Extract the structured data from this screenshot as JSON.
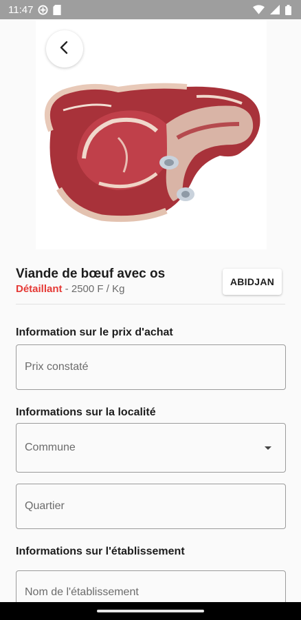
{
  "status_bar": {
    "time": "11:47"
  },
  "product": {
    "name": "Viande de bœuf avec os",
    "seller_type": "Détaillant",
    "separator": " - ",
    "price": "2500 F",
    "unit": " / Kg",
    "city": "ABIDJAN"
  },
  "sections": {
    "purchase_price": {
      "label": "Information sur le prix d'achat",
      "price_placeholder": "Prix constaté"
    },
    "locality": {
      "label": "Informations sur la localité",
      "commune_placeholder": "Commune",
      "quartier_placeholder": "Quartier"
    },
    "establishment": {
      "label": "Informations sur l'établissement",
      "name_placeholder": "Nom de l'établissement"
    }
  },
  "colors": {
    "accent_red": "#e53935",
    "status_bar": "#9e9e9e",
    "background": "#fafafa"
  },
  "icons": [
    "settings-circle-icon",
    "sim-card-icon",
    "wifi-icon",
    "signal-icon",
    "battery-icon",
    "back-arrow-icon",
    "dropdown-caret-icon"
  ]
}
